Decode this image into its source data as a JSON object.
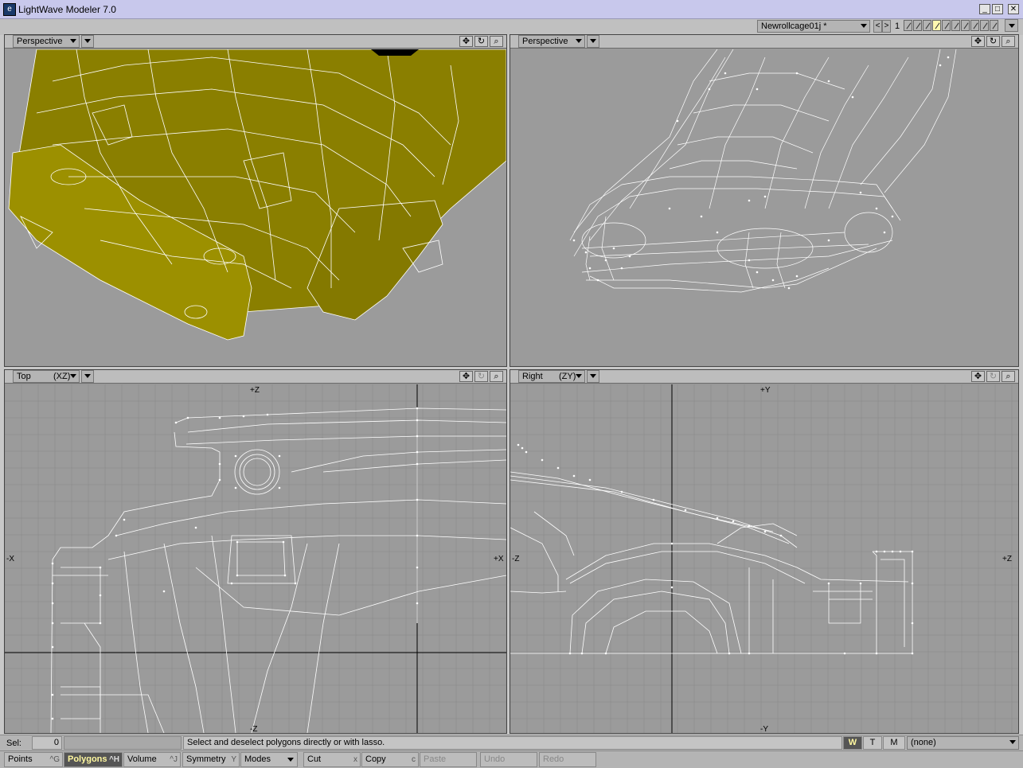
{
  "app": {
    "title": "LightWave Modeler 7.0"
  },
  "window_controls": {
    "minimize": "_",
    "maximize": "□",
    "close": "✕"
  },
  "toolbar": {
    "object_name": "Newrollcage01j *",
    "layer_prev": "<",
    "layer_next": ">",
    "layer_number": "1"
  },
  "viewports": {
    "tl": {
      "view": "Perspective",
      "axes": ""
    },
    "tr": {
      "view": "Perspective",
      "axes": ""
    },
    "bl": {
      "view": "Top",
      "axes": "(XZ)",
      "axis_labels": {
        "top": "+Z",
        "bottom": "-Z",
        "left": "-X",
        "right": "+X"
      }
    },
    "br": {
      "view": "Right",
      "axes": "(ZY)",
      "axis_labels": {
        "top": "+Y",
        "bottom": "-Y",
        "left": "-Z",
        "right": "+Z"
      }
    }
  },
  "status": {
    "sel_label": "Sel:",
    "sel_count": "0",
    "message": "Select and deselect polygons directly or with lasso.",
    "wtm": [
      "W",
      "T",
      "M"
    ],
    "surface": "(none)"
  },
  "commands": {
    "points": {
      "label": "Points",
      "shortcut": "^G"
    },
    "polygons": {
      "label": "Polygons",
      "shortcut": "^H"
    },
    "volume": {
      "label": "Volume",
      "shortcut": "^J"
    },
    "symmetry": {
      "label": "Symmetry",
      "shortcut": "Y"
    },
    "modes": {
      "label": "Modes"
    },
    "cut": {
      "label": "Cut",
      "shortcut": "x"
    },
    "copy": {
      "label": "Copy",
      "shortcut": "c"
    },
    "paste": {
      "label": "Paste"
    },
    "undo": {
      "label": "Undo"
    },
    "redo": {
      "label": "Redo"
    }
  },
  "colors": {
    "viewport_bg": "#9b9b9b",
    "model_fill": "#8b8000",
    "wire": "#ffffff",
    "title_bg": "#c8c8ec",
    "active_layer": "#fff8b0"
  }
}
